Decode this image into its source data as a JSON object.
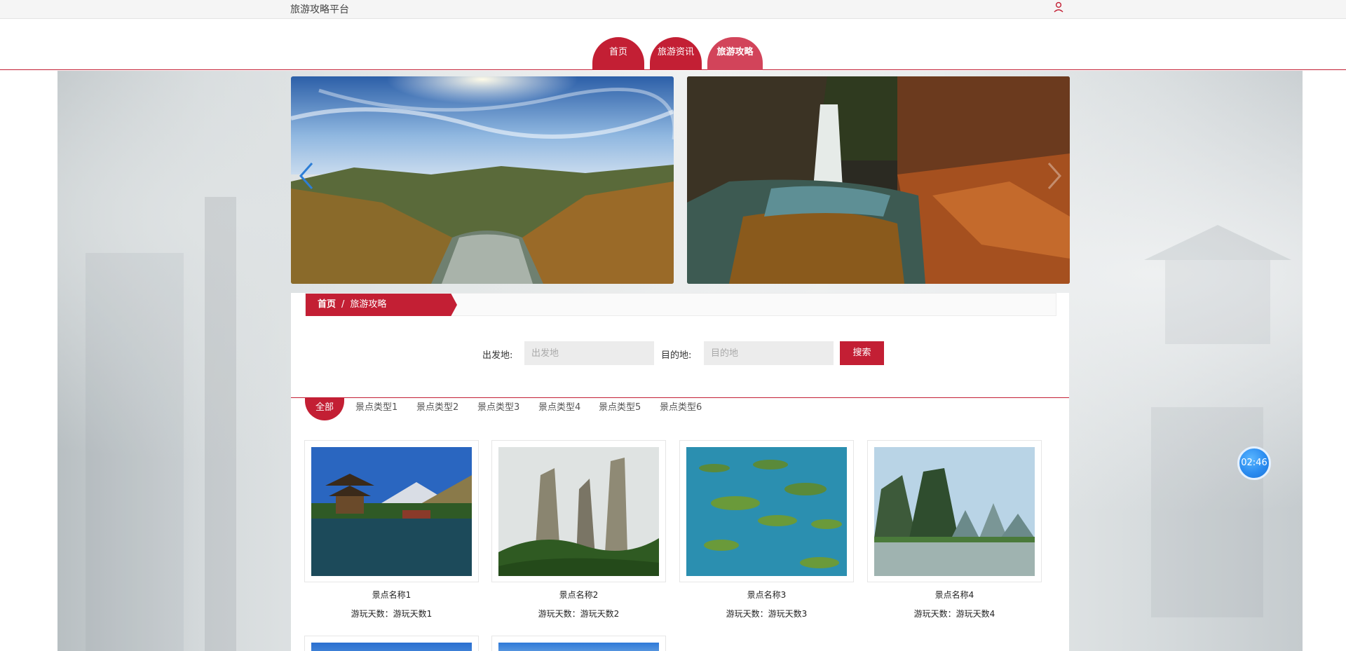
{
  "topbar": {
    "brand": "旅游攻略平台"
  },
  "nav": {
    "tabs": [
      "首页",
      "旅游资讯",
      "旅游攻略"
    ],
    "active_index": 2
  },
  "breadcrumb": {
    "home": "首页",
    "sep": "/",
    "current": "旅游攻略"
  },
  "search": {
    "from_label": "出发地:",
    "from_placeholder": "出发地",
    "to_label": "目的地:",
    "to_placeholder": "目的地",
    "button": "搜索"
  },
  "categories": [
    "全部",
    "景点类型1",
    "景点类型2",
    "景点类型3",
    "景点类型4",
    "景点类型5",
    "景点类型6"
  ],
  "cards": [
    {
      "name": "景点名称1",
      "days": "游玩天数：游玩天数1"
    },
    {
      "name": "景点名称2",
      "days": "游玩天数：游玩天数2"
    },
    {
      "name": "景点名称3",
      "days": "游玩天数：游玩天数3"
    },
    {
      "name": "景点名称4",
      "days": "游玩天数：游玩天数4"
    }
  ],
  "timer": "02:46",
  "colors": {
    "accent": "#c31f34",
    "accent_light": "#d2445a",
    "timer": "#2b8cf0"
  }
}
